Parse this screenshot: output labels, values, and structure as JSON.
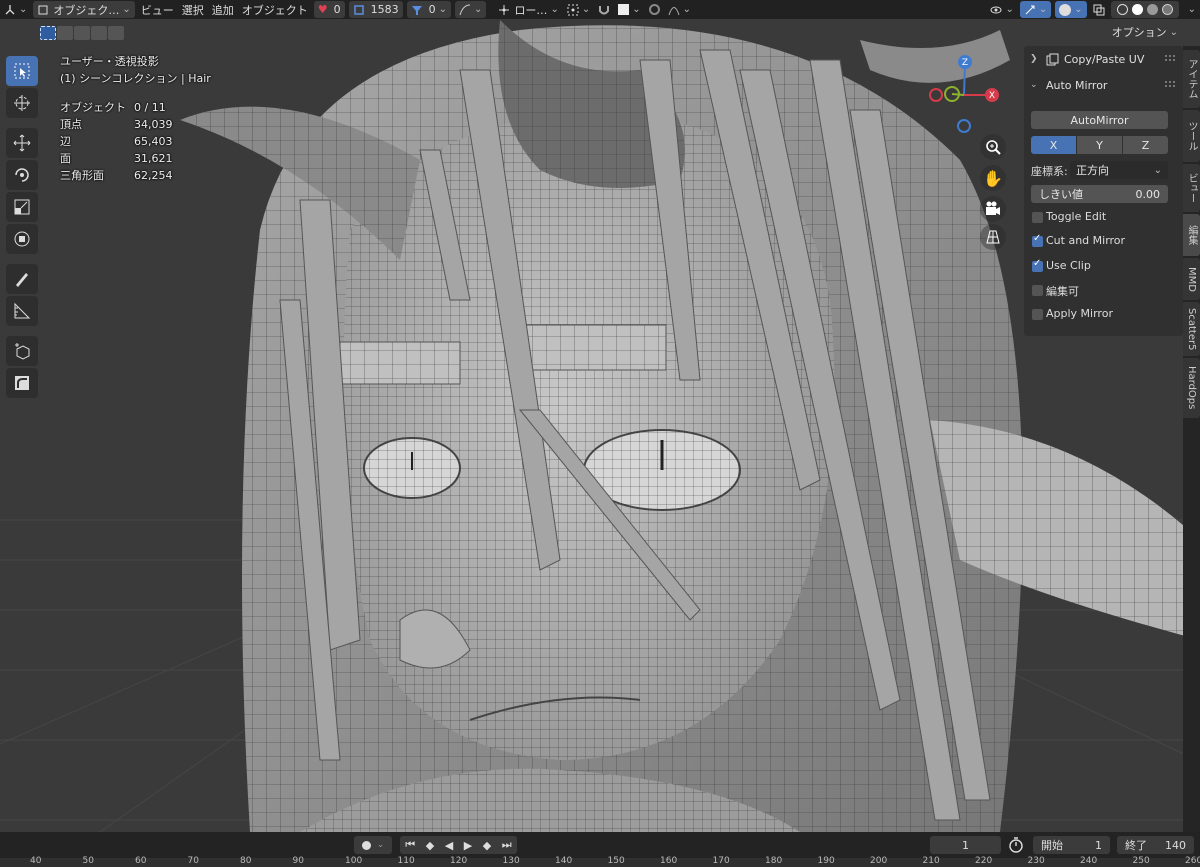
{
  "header": {
    "mode": "オブジェク…",
    "menu": [
      "ビュー",
      "選択",
      "追加",
      "オブジェクト"
    ],
    "proportional_count": "0",
    "counter_a": "1583",
    "counter_b": "0",
    "transform_orientation": "ロー…",
    "options_label": "オプション"
  },
  "overlay": {
    "view_name": "ユーザー・透視投影",
    "collection": "(1) シーンコレクション | Hair",
    "stats": [
      {
        "label": "オブジェクト",
        "value": "0 / 11"
      },
      {
        "label": "頂点",
        "value": "34,039"
      },
      {
        "label": "辺",
        "value": "65,403"
      },
      {
        "label": "面",
        "value": "31,621"
      },
      {
        "label": "三角形面",
        "value": "62,254"
      }
    ]
  },
  "gizmo": {
    "z": "Z",
    "x": "X",
    "y": "Y"
  },
  "panel": {
    "copypaste_title": "Copy/Paste UV",
    "automirror_title": "Auto Mirror",
    "automirror_button": "AutoMirror",
    "axes": [
      "X",
      "Y",
      "Z"
    ],
    "coord_label": "座標系:",
    "coord_value": "正方向",
    "threshold_label": "しきい値",
    "threshold_value": "0.00",
    "toggles": [
      {
        "label": "Toggle Edit",
        "checked": false
      },
      {
        "label": "Cut and Mirror",
        "checked": true
      },
      {
        "label": "Use Clip",
        "checked": true
      },
      {
        "label": "編集可",
        "checked": false
      },
      {
        "label": "Apply Mirror",
        "checked": false
      }
    ]
  },
  "tabs": [
    "アイテム",
    "ツール",
    "ビュー",
    "編集",
    "MMD",
    "Scatter5",
    "HardOps"
  ],
  "timeline": {
    "current_frame": "1",
    "start_label": "開始",
    "start_value": "1",
    "end_label": "終了",
    "end_value": "140"
  },
  "ruler_ticks": [
    "40",
    "50",
    "60",
    "70",
    "80",
    "90",
    "100",
    "110",
    "120",
    "130",
    "140",
    "150",
    "160",
    "170",
    "180",
    "190",
    "200",
    "210",
    "220",
    "230",
    "240",
    "250",
    "260"
  ],
  "colors": {
    "accent": "#4772b3",
    "panel": "#303030",
    "x_axis": "#d63b4b",
    "y_axis": "#8bb32c",
    "z_axis": "#3f7bd1"
  }
}
